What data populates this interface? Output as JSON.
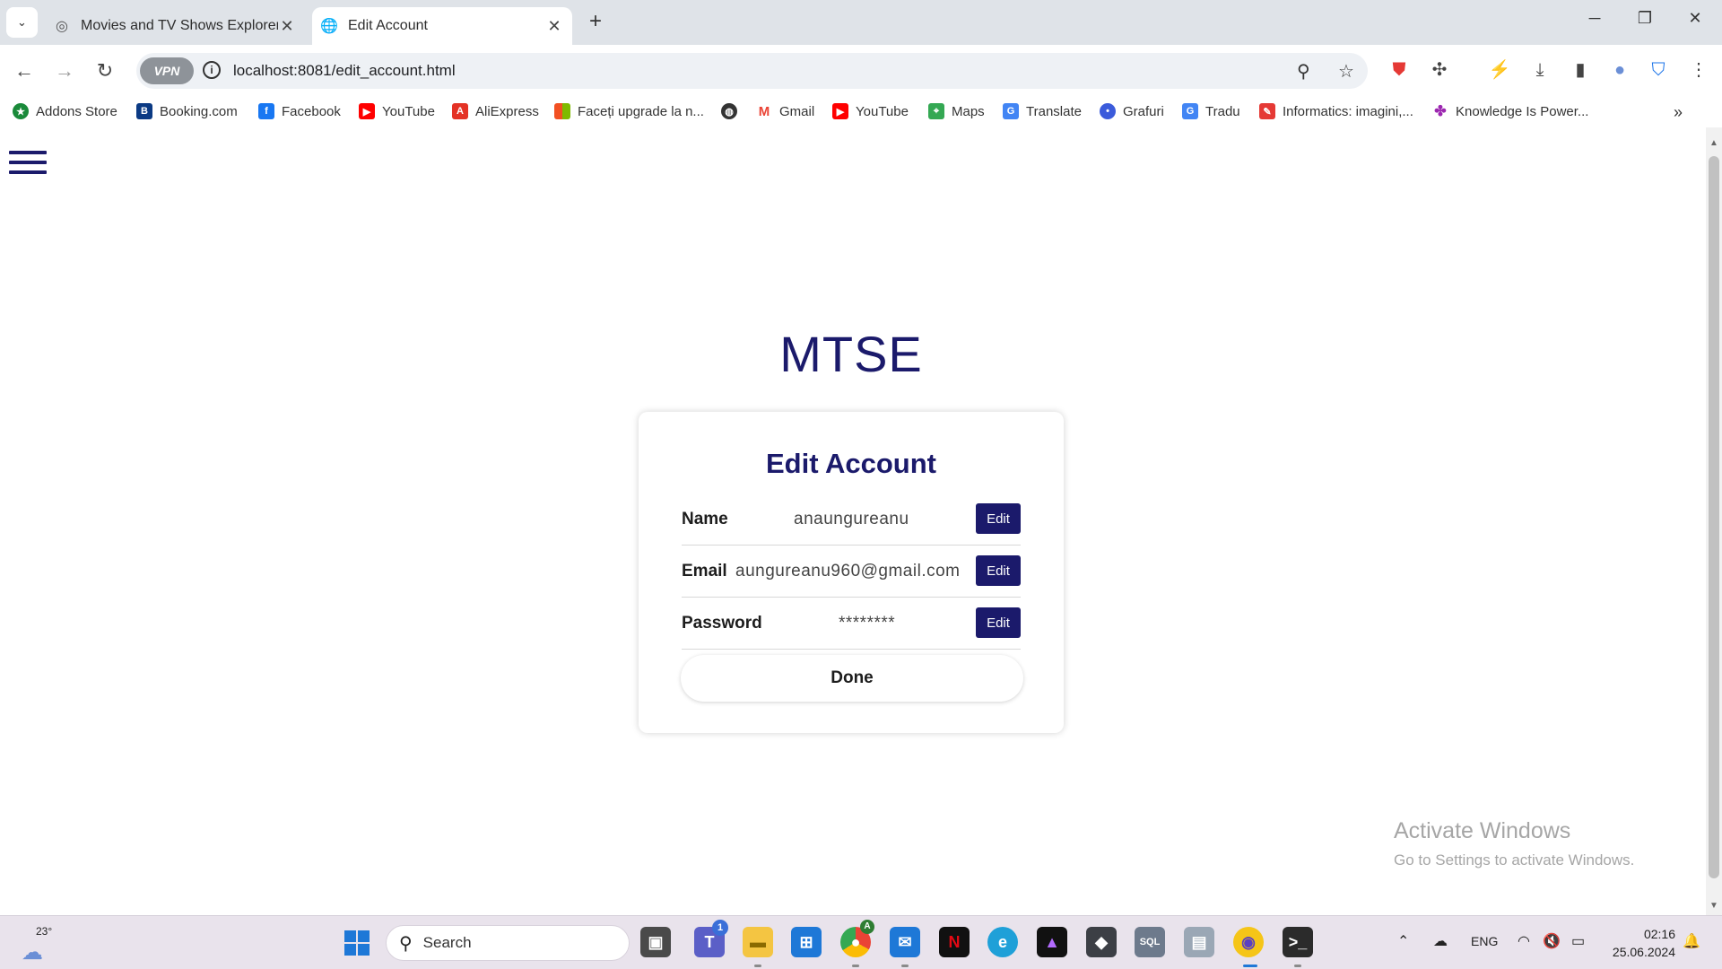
{
  "browser": {
    "tabs": [
      {
        "title": "Movies and TV Shows Explorer",
        "active": false
      },
      {
        "title": "Edit Account",
        "active": true
      }
    ],
    "address": "localhost:8081/edit_account.html",
    "vpn_label": "VPN",
    "bookmarks": [
      {
        "label": "Addons Store",
        "icon": "addons-store-icon",
        "color": "#1a8a3a"
      },
      {
        "label": "Booking.com",
        "icon": "booking-icon",
        "color": "#0b3a84"
      },
      {
        "label": "Facebook",
        "icon": "facebook-icon",
        "color": "#1877f2"
      },
      {
        "label": "YouTube",
        "icon": "youtube-icon",
        "color": "#ff0000"
      },
      {
        "label": "AliExpress",
        "icon": "aliexpress-icon",
        "color": "#e43225"
      },
      {
        "label": "Faceți upgrade la n...",
        "icon": "microsoft-icon",
        "color": "#7fba00"
      },
      {
        "label": "",
        "icon": "globe-icon",
        "color": "#333333"
      },
      {
        "label": "Gmail",
        "icon": "gmail-icon",
        "color": "#ea4335"
      },
      {
        "label": "YouTube",
        "icon": "youtube-icon",
        "color": "#ff0000"
      },
      {
        "label": "Maps",
        "icon": "maps-icon",
        "color": "#34a853"
      },
      {
        "label": "Translate",
        "icon": "translate-icon",
        "color": "#4285f4"
      },
      {
        "label": "Grafuri",
        "icon": "grafuri-icon",
        "color": "#3b5bdb"
      },
      {
        "label": "Tradu",
        "icon": "translate-icon",
        "color": "#4285f4"
      },
      {
        "label": "Informatics: imagini,...",
        "icon": "informatics-icon",
        "color": "#e53935"
      },
      {
        "label": "Knowledge Is Power...",
        "icon": "pinwheel-icon",
        "color": "#9c27b0"
      }
    ]
  },
  "page": {
    "brand": "MTSE",
    "card_title": "Edit Account",
    "fields": [
      {
        "label": "Name",
        "value": "anaungureanu",
        "button": "Edit"
      },
      {
        "label": "Email",
        "value": "aungureanu960@gmail.com",
        "button": "Edit"
      },
      {
        "label": "Password",
        "value": "********",
        "button": "Edit"
      }
    ],
    "done_label": "Done",
    "watermark_title": "Activate Windows",
    "watermark_sub": "Go to Settings to activate Windows."
  },
  "taskbar": {
    "weather_temp": "23°",
    "search_label": "Search",
    "teams_badge": "1",
    "chrome_badge": "A",
    "lang": "ENG",
    "time": "02:16",
    "date": "25.06.2024"
  },
  "colors": {
    "accent": "#1b1a6b",
    "tabbar": "#dfe3e8",
    "taskbar": "#e9e3ec"
  }
}
